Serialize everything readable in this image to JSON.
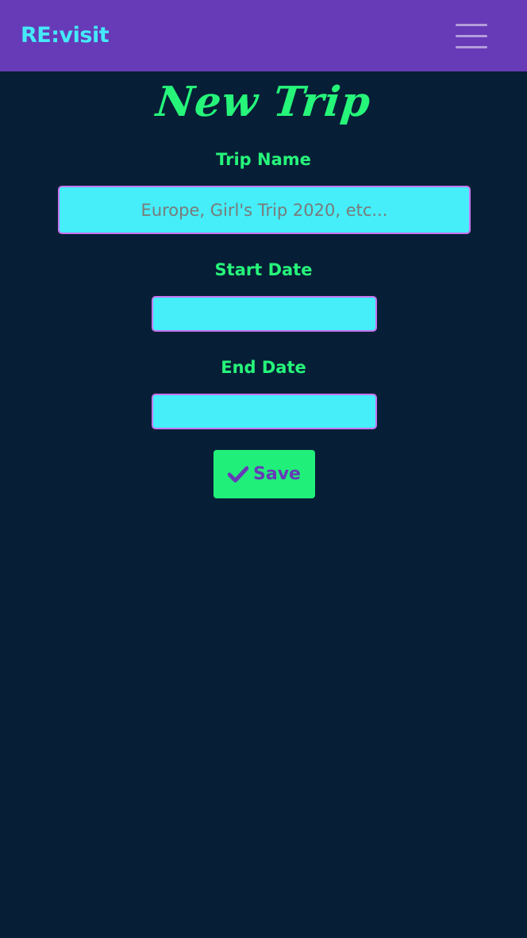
{
  "navbar": {
    "brand": "RE:visit",
    "menu_icon": "hamburger-menu-icon",
    "background": "#673ab7",
    "brand_color": "#45e9f8"
  },
  "page": {
    "title": "New Trip",
    "background": "#061f36",
    "accent": "#26f57a"
  },
  "form": {
    "trip_name": {
      "label": "Trip Name",
      "placeholder": "Europe, Girl's Trip 2020, etc...",
      "value": ""
    },
    "start_date": {
      "label": "Start Date",
      "value": ""
    },
    "end_date": {
      "label": "End Date",
      "value": ""
    },
    "field_background": "#45eef8",
    "field_border": "#c675f0",
    "save": {
      "label": "Save",
      "icon": "checkmark-icon",
      "background": "#20f07a",
      "text_color": "#673ab7"
    }
  }
}
